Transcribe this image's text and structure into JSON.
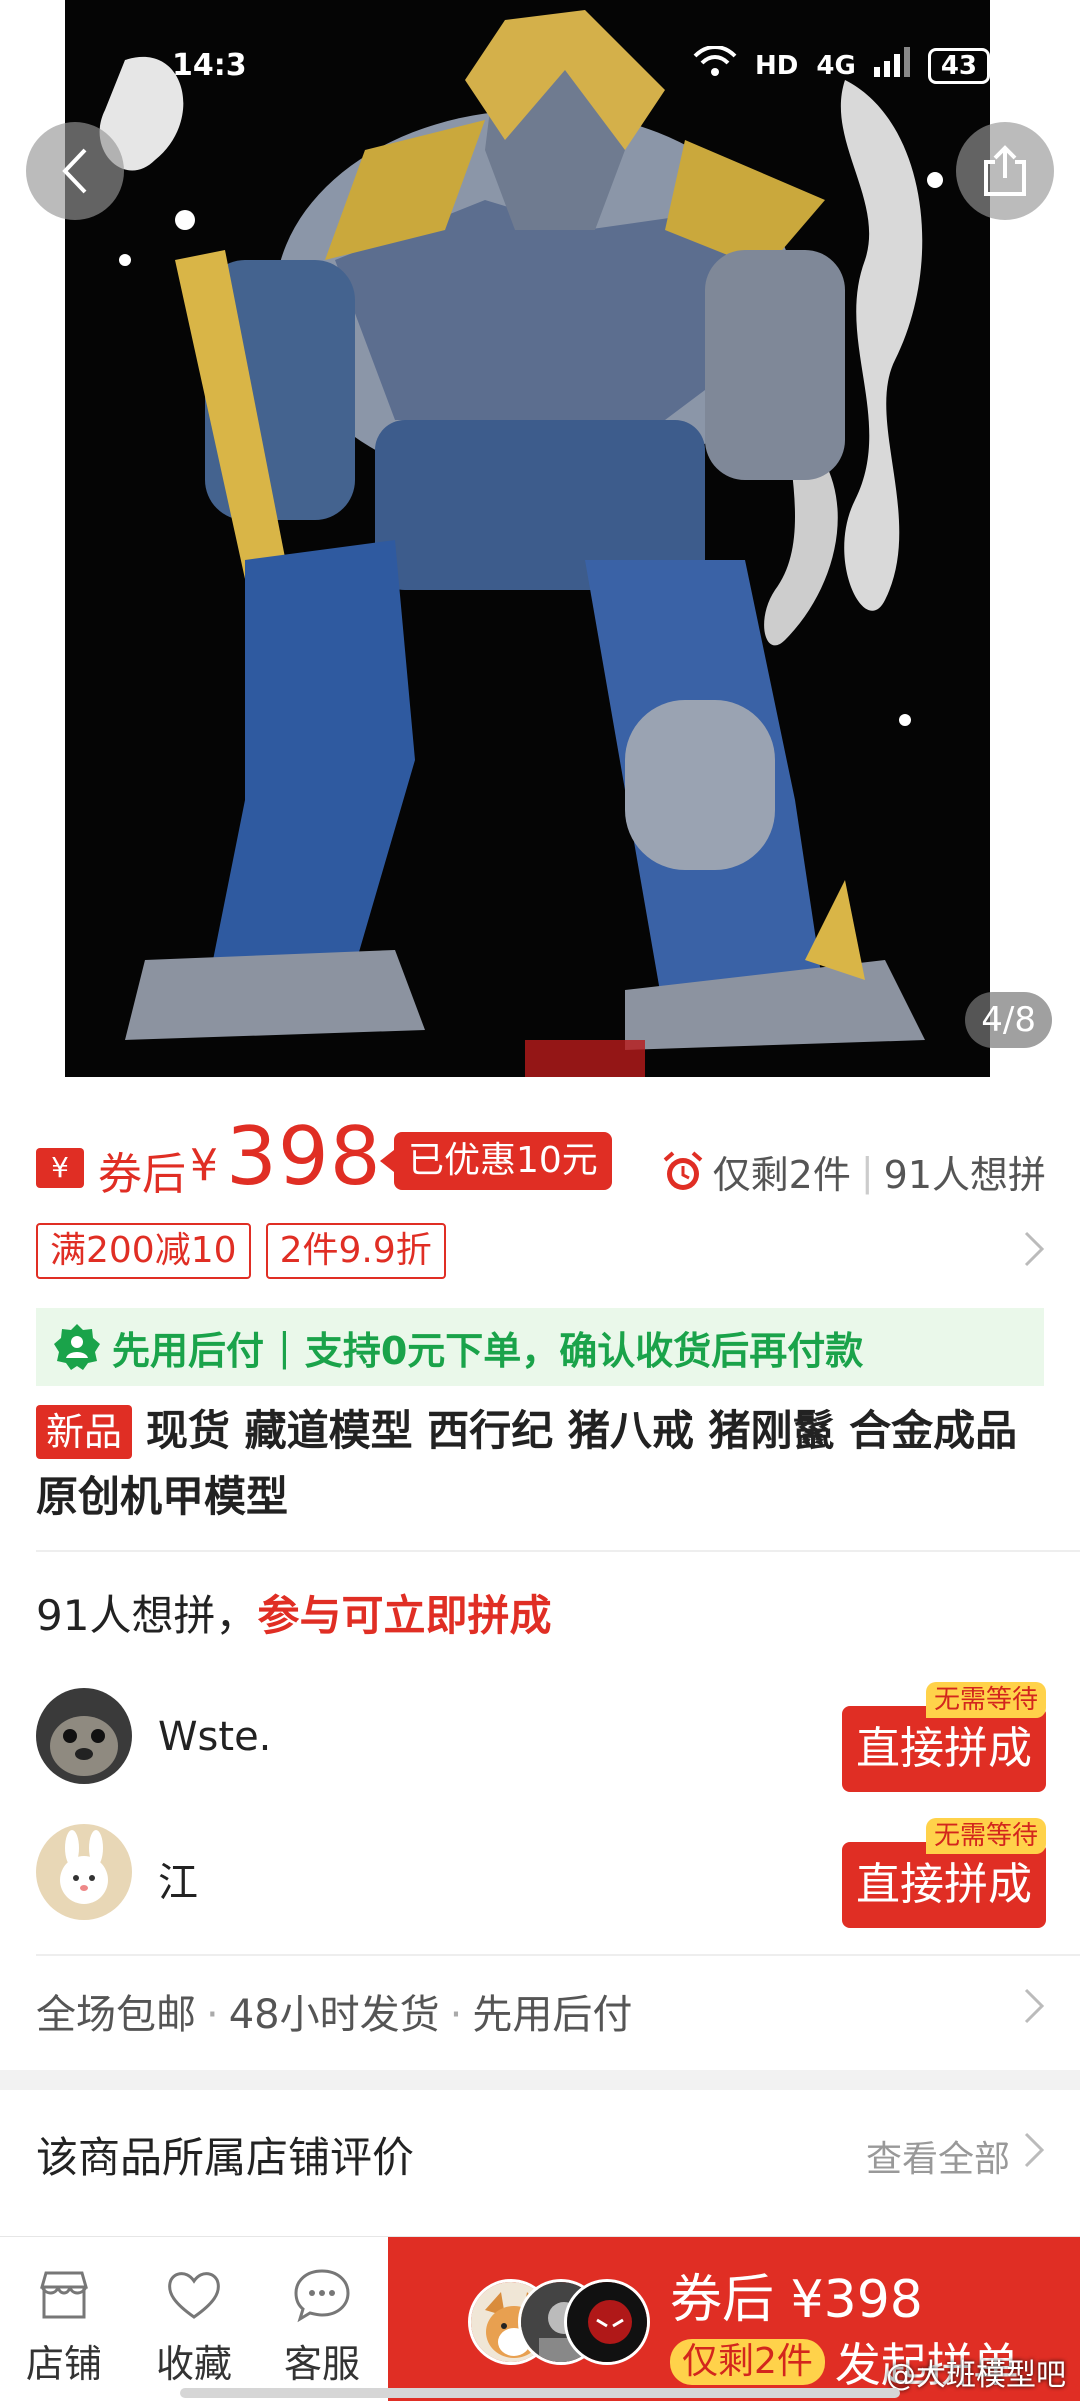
{
  "status_bar": {
    "time": "14:3",
    "network": "HD",
    "signal": "4G",
    "battery": "43"
  },
  "gallery": {
    "counter": "4/8"
  },
  "price": {
    "label": "券后",
    "currency": "¥",
    "value": "398",
    "discount_tag": "已优惠10元",
    "stock": "仅剩2件",
    "wanters": "91人想拼"
  },
  "promos": [
    "满200减10",
    "2件9.9折"
  ],
  "pay_later": {
    "title": "先用后付",
    "detail": "支持0元下单，确认收货后再付款"
  },
  "product": {
    "badge": "新品",
    "title": "现货 藏道模型 西行纪 猪八戒 猪刚鬣 合金成品 原创机甲模型"
  },
  "group_buy": {
    "count_text": "91人想拼，",
    "accent_text": "参与可立即拼成",
    "rows": [
      {
        "name": "Wste.",
        "button": "直接拼成",
        "tag": "无需等待"
      },
      {
        "name": "江",
        "button": "直接拼成",
        "tag": "无需等待"
      }
    ]
  },
  "services": [
    "全场包邮",
    "48小时发货",
    "先用后付"
  ],
  "reviews": {
    "title": "该商品所属店铺评价",
    "more": "查看全部"
  },
  "bottom_bar": {
    "tabs": [
      "店铺",
      "收藏",
      "客服"
    ],
    "cta_price": "券后 ¥398",
    "cta_stock": "仅剩2件",
    "cta_action": "发起拼单"
  },
  "watermark": "@大班模型吧",
  "colors": {
    "accent": "#e02e24",
    "green": "#1aa34a",
    "yellow": "#ffd24a"
  }
}
